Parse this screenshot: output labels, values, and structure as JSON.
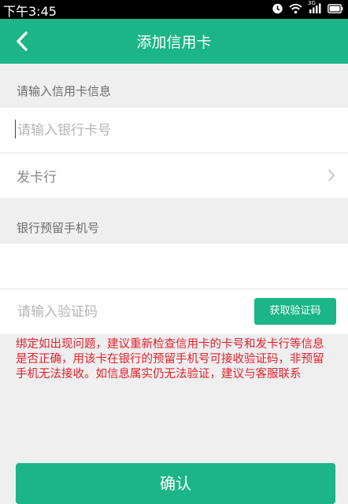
{
  "status_bar": {
    "time": "下午3:45",
    "icons": [
      "alarm-icon",
      "wifi-icon",
      "signal-3g-icon",
      "battery-icon"
    ],
    "signal_label": "3G"
  },
  "header": {
    "title": "添加信用卡",
    "back_icon": "chevron-left-icon"
  },
  "card_section": {
    "label": "请输入信用卡信息",
    "card_number_placeholder": "请输入银行卡号",
    "issuer_label": "发卡行"
  },
  "phone_section": {
    "label": "银行预留手机号",
    "phone_value": "",
    "code_placeholder": "请输入验证码",
    "get_code_label": "获取验证码"
  },
  "notice": "绑定如出现问题，建议重新检查信用卡的卡号和发卡行等信息是否正确，用该卡在银行的预留手机号可接收验证码，非预留手机无法接收。如信息属实仍无法验证，建议与客服联系",
  "confirm_label": "确认",
  "colors": {
    "accent": "#1cb588",
    "notice": "#e5202a",
    "background": "#efeff0"
  }
}
